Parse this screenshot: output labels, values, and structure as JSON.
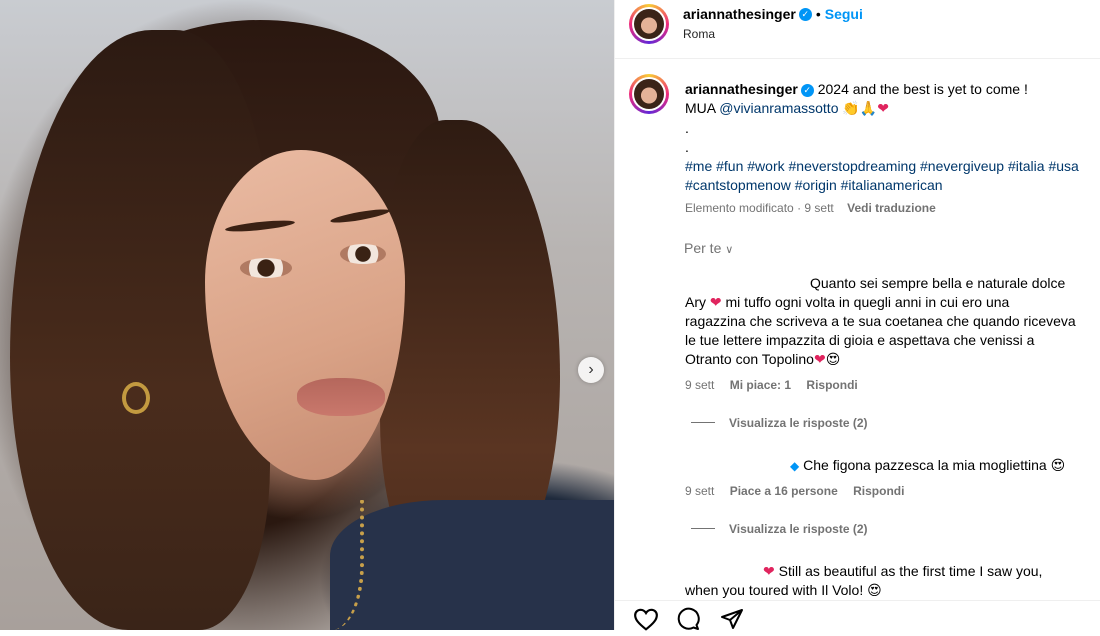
{
  "post": {
    "username": "ariannathesinger",
    "follow_label": "Segui",
    "location": "Roma",
    "separator": "•"
  },
  "caption": {
    "username": "ariannathesinger",
    "line1": "2024 and the best is yet to come !",
    "mua_prefix": "MUA",
    "mua_handle": "@vivianramassotto",
    "mua_emojis": "👏🙏",
    "dot1": ".",
    "dot2": ".",
    "tags_line1": "#me #fun #work #neverstopdreaming #nevergiveup #italia #usa",
    "tags_line2": "#cantstopmenow #origin #italianamerican",
    "edited": "Elemento modificato",
    "time": "9 sett",
    "translate": "Vedi traduzione"
  },
  "filter": {
    "label": "Per te"
  },
  "comments": [
    {
      "line1": "Quanto sei sempre bella e naturale dolce",
      "line2a": "Ary",
      "line2b": "mi tuffo ogni volta in quegli anni in cui ero una",
      "line3": "ragazzina che scriveva a te sua coetanea che quando riceveva",
      "line4": "le tue lettere impazzita di gioia e aspettava che venissi a",
      "line5": "Otranto con Topolino",
      "line5_emoji": "😍",
      "time": "9 sett",
      "likes": "Mi piace: 1",
      "reply": "Rispondi",
      "view_replies": "Visualizza le risposte (2)"
    },
    {
      "text": "Che figona pazzesca la mia mogliettina",
      "emoji": "😍",
      "time": "9 sett",
      "likes": "Piace a 16 persone",
      "reply": "Rispondi",
      "view_replies": "Visualizza le risposte (2)"
    },
    {
      "line1": "Still as beautiful as the first time I saw you,",
      "line2": "when you toured with Il Volo!",
      "line2_emoji": "😍"
    }
  ],
  "icons": {
    "next": "chevron-right-icon",
    "like": "heart-icon",
    "comment": "comment-icon",
    "share": "send-icon",
    "verified": "verified-badge-icon"
  },
  "colors": {
    "link": "#0095f6",
    "hashtag": "#00376b",
    "meta": "#737373",
    "heart": "#e0245e"
  }
}
